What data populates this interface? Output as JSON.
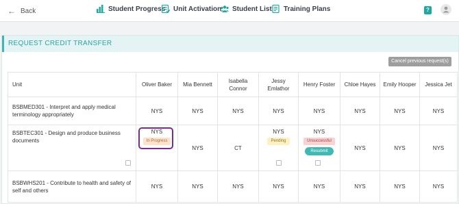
{
  "header": {
    "back_label": "Back",
    "nav": [
      {
        "label": "Student Progress",
        "icon": "bar-chart-icon"
      },
      {
        "label": "Unit Activation",
        "icon": "checklist-icon"
      },
      {
        "label": "Student List",
        "icon": "users-icon"
      },
      {
        "label": "Training Plans",
        "icon": "document-icon"
      }
    ],
    "help_icon": "?",
    "accent": "#1ba9a0"
  },
  "panel": {
    "title": "REQUEST CREDIT TRANSFER",
    "cancel_label": "Cancel previous request(s)"
  },
  "table": {
    "unit_header": "Unit",
    "students": [
      "Oliver Baker",
      "Mia Bennett",
      "Isabella Connor",
      "Jessy Emlathor",
      "Henry Foster",
      "Chloe Hayes",
      "Emily Hooper",
      "Jessica Jet"
    ],
    "rows": [
      {
        "unit": "BSBMED301 - Interpret and apply medical terminology appropriately",
        "cells": [
          "NYS",
          "NYS",
          "NYS",
          "NYS",
          "NYS",
          "NYS",
          "NYS",
          "NYS"
        ]
      },
      {
        "unit": "BSBTEC301 - Design and produce business documents",
        "cells": [
          "NYS",
          "NYS",
          "CT",
          "NYS",
          "NYS",
          "NYS",
          "NYS",
          "NYS"
        ],
        "oliver_status": "In Progress",
        "jessy_status": "Pending",
        "henry_status": "Unsuccessful",
        "henry_action": "Resubmit"
      },
      {
        "unit": "BSBWHS201 - Contribute to health and safety of self and others",
        "cells": [
          "NYS",
          "NYS",
          "NYS",
          "NYS",
          "NYS",
          "NYS",
          "NYS",
          "NYS"
        ]
      }
    ]
  },
  "colors": {
    "teal": "#3fb6b6",
    "highlight": "#7b2a8e"
  }
}
